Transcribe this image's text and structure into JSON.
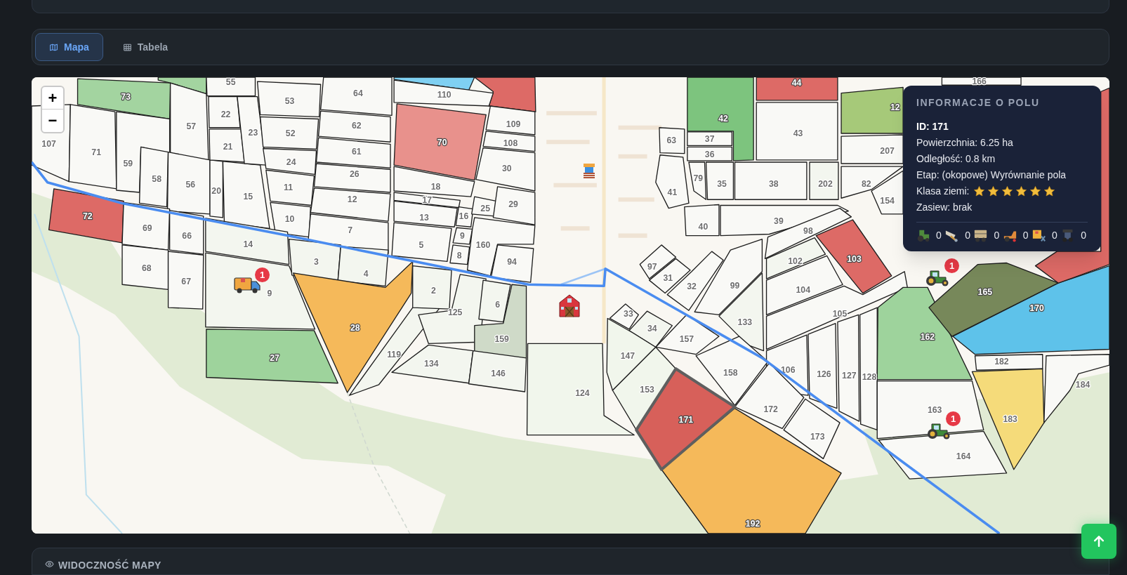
{
  "tabs": [
    {
      "label": "Mapa",
      "kind": "map",
      "selected": true
    },
    {
      "label": "Tabela",
      "kind": "table",
      "selected": false
    }
  ],
  "map": {
    "zoom_in": "+",
    "zoom_out": "−",
    "fields": [
      {
        "label": "73",
        "color": "#a3d4a0",
        "selected": false
      },
      {
        "color": "#a3d4a0",
        "selected": false
      },
      {
        "label": "107",
        "color": "#f9f9f6",
        "selected": false
      },
      {
        "label": "57",
        "color": "#f9f9f6",
        "selected": false
      },
      {
        "label": "71",
        "color": "#f9f9f6",
        "selected": false
      },
      {
        "label": "59",
        "color": "#f9f9f6",
        "selected": false
      },
      {
        "label": "58",
        "color": "#f9f9f6",
        "selected": false
      },
      {
        "label": "56",
        "color": "#f9f9f6",
        "selected": false
      },
      {
        "label": "20",
        "color": "#f9f9f6",
        "selected": false
      },
      {
        "label": "15",
        "color": "#f9f9f6",
        "selected": false
      },
      {
        "label": "55",
        "color": "#f9f9f6",
        "selected": false
      },
      {
        "label": "22",
        "color": "#f9f9f6",
        "selected": false
      },
      {
        "label": "21",
        "color": "#f9f9f6",
        "selected": false
      },
      {
        "label": "23",
        "color": "#f9f9f6",
        "selected": false
      },
      {
        "label": "53",
        "color": "#f9f9f6",
        "selected": false
      },
      {
        "label": "52",
        "color": "#f9f9f6",
        "selected": false
      },
      {
        "label": "24",
        "color": "#f9f9f6",
        "selected": false
      },
      {
        "label": "11",
        "color": "#f9f9f6",
        "selected": false
      },
      {
        "label": "10",
        "color": "#f9f9f6",
        "selected": false
      },
      {
        "label": "64",
        "color": "#f9f9f6",
        "selected": false
      },
      {
        "label": "62",
        "color": "#f9f9f6",
        "selected": false
      },
      {
        "label": "61",
        "color": "#f9f9f6",
        "selected": false
      },
      {
        "label": "26",
        "color": "#f9f9f6",
        "selected": false
      },
      {
        "label": "12",
        "color": "#f9f9f6",
        "selected": false
      },
      {
        "label": "7",
        "color": "#f9f9f6",
        "selected": false
      },
      {
        "label": "72",
        "color": "#dd6a66",
        "selected": false
      },
      {
        "label": "69",
        "color": "#f9f9f6",
        "selected": false
      },
      {
        "label": "66",
        "color": "#f9f9f6",
        "selected": false
      },
      {
        "label": "68",
        "color": "#f9f9f6",
        "selected": false
      },
      {
        "label": "67",
        "color": "#f9f9f6",
        "selected": false
      },
      {
        "label": "14",
        "color": "#f3f6ef",
        "selected": false
      },
      {
        "label": "9",
        "color": "#f3f6ef",
        "selected": false
      },
      {
        "label": "3",
        "color": "#f3f6ef",
        "selected": false
      },
      {
        "label": "4",
        "color": "#f3f6ef",
        "selected": false
      },
      {
        "label": "28",
        "color": "#f5b95a",
        "selected": false
      },
      {
        "label": "27",
        "color": "#9ed39c",
        "selected": false
      },
      {
        "label": "119",
        "color": "#f3f6ef",
        "selected": false
      },
      {
        "label": "2",
        "color": "#f3f6ef",
        "selected": false
      },
      {
        "label": "125",
        "color": "#f3f6ef",
        "selected": false
      },
      {
        "label": "6",
        "color": "#f3f6ef",
        "selected": false
      },
      {
        "label": "159",
        "color": "#cfdac8",
        "selected": false
      },
      {
        "label": "134",
        "color": "#f3f6ef",
        "selected": false
      },
      {
        "label": "146",
        "color": "#f3f6ef",
        "selected": false
      },
      {
        "label": "124",
        "color": "#f1f6ec",
        "selected": false
      },
      {
        "color": "#7fd0f2",
        "selected": false
      },
      {
        "color": "#dd6a66",
        "selected": false
      },
      {
        "label": "110",
        "color": "#f9f9f6",
        "selected": false
      },
      {
        "label": "70",
        "color": "#e8918c",
        "selected": false
      },
      {
        "label": "109",
        "color": "#f9f9f6",
        "selected": false
      },
      {
        "label": "108",
        "color": "#f9f9f6",
        "selected": false
      },
      {
        "label": "30",
        "color": "#f9f9f6",
        "selected": false
      },
      {
        "label": "18",
        "color": "#f9f9f6",
        "selected": false
      },
      {
        "label": "17",
        "color": "#f9f9f6",
        "selected": false
      },
      {
        "label": "13",
        "color": "#f9f9f6",
        "selected": false
      },
      {
        "label": "16",
        "color": "#f9f9f6",
        "selected": false
      },
      {
        "label": "25",
        "color": "#f9f9f6",
        "selected": false
      },
      {
        "label": "29",
        "color": "#f9f9f6",
        "selected": false
      },
      {
        "label": "9",
        "color": "#f9f9f6",
        "selected": false
      },
      {
        "label": "8",
        "color": "#f9f9f6",
        "selected": false
      },
      {
        "label": "5",
        "color": "#f9f9f6",
        "selected": false
      },
      {
        "label": "160",
        "color": "#f9f9f6",
        "selected": false
      },
      {
        "label": "94",
        "color": "#f9f9f6",
        "selected": false
      },
      {
        "label": "63",
        "color": "#f9f9f6",
        "selected": false
      },
      {
        "label": "42",
        "color": "#7dc47e",
        "selected": false
      },
      {
        "label": "37",
        "color": "#f9f9f6",
        "selected": false
      },
      {
        "label": "36",
        "color": "#f9f9f6",
        "selected": false
      },
      {
        "label": "44",
        "color": "#dd6a66",
        "selected": false
      },
      {
        "label": "166",
        "color": "#f9f9f6",
        "selected": false
      },
      {
        "label": "43",
        "color": "#f9f9f6",
        "selected": false
      },
      {
        "label": "41",
        "color": "#f9f9f6",
        "selected": false
      },
      {
        "label": "79",
        "color": "#f9f9f6",
        "selected": false
      },
      {
        "label": "35",
        "color": "#f9f9f6",
        "selected": false
      },
      {
        "label": "38",
        "color": "#f9f9f6",
        "selected": false
      },
      {
        "label": "202",
        "color": "#f3f6ef",
        "selected": false
      },
      {
        "label": "40",
        "color": "#f9f9f6",
        "selected": false
      },
      {
        "label": "39",
        "color": "#f9f9f6",
        "selected": false
      },
      {
        "label": "12",
        "color": "#a6c979",
        "selected": false
      },
      {
        "label": "207",
        "color": "#f9f9f6",
        "selected": false
      },
      {
        "label": "82",
        "color": "#f9f9f6",
        "selected": false
      },
      {
        "label": "154",
        "color": "#f9f9f6",
        "selected": false
      },
      {
        "label": "98",
        "color": "#f9f9f6",
        "selected": false
      },
      {
        "label": "102",
        "color": "#f3f6ef",
        "selected": false
      },
      {
        "label": "103",
        "color": "#dd6a66",
        "selected": false
      },
      {
        "label": "104",
        "color": "#f9f9f6",
        "selected": false
      },
      {
        "label": "105",
        "color": "#f9f9f6",
        "selected": false
      },
      {
        "label": "106",
        "color": "#f9f9f6",
        "selected": false
      },
      {
        "label": "126",
        "color": "#f9f9f6",
        "selected": false
      },
      {
        "label": "127",
        "color": "#f9f9f6",
        "selected": false
      },
      {
        "label": "128",
        "color": "#f9f9f6",
        "selected": false
      },
      {
        "label": "162",
        "color": "#9ed39c",
        "selected": false
      },
      {
        "label": "165",
        "color": "#77885a",
        "selected": false
      },
      {
        "label": "170",
        "color": "#5ec2ea",
        "selected": false
      },
      {
        "color": "#dd6a66",
        "selected": false
      },
      {
        "label": "182",
        "color": "#f9f9f6",
        "selected": false
      },
      {
        "label": "183",
        "color": "#f5db7a",
        "selected": false
      },
      {
        "label": "184",
        "color": "#f9f9f6",
        "selected": false
      },
      {
        "label": "163",
        "color": "#f9f9f6",
        "selected": false
      },
      {
        "label": "164",
        "color": "#f9f9f6",
        "selected": false
      },
      {
        "label": "97",
        "color": "#f9f9f6",
        "selected": false
      },
      {
        "label": "31",
        "color": "#f9f9f6",
        "selected": false
      },
      {
        "label": "32",
        "color": "#f9f9f6",
        "selected": false
      },
      {
        "label": "99",
        "color": "#f9f9f6",
        "selected": false
      },
      {
        "label": "133",
        "color": "#f3f6ef",
        "selected": false
      },
      {
        "label": "33",
        "color": "#f9f9f6",
        "selected": false
      },
      {
        "label": "34",
        "color": "#f3f6ef",
        "selected": false
      },
      {
        "label": "157",
        "color": "#f9f9f6",
        "selected": false
      },
      {
        "label": "147",
        "color": "#f1f6ec",
        "selected": false
      },
      {
        "label": "158",
        "color": "#f9f9f6",
        "selected": false
      },
      {
        "label": "153",
        "color": "#f1f6ec",
        "selected": false
      },
      {
        "label": "172",
        "color": "#f9f9f6",
        "selected": false
      },
      {
        "label": "171",
        "color": "#d7605a",
        "selected": true
      },
      {
        "label": "173",
        "color": "#f9f9f6",
        "selected": false
      },
      {
        "label": "192",
        "color": "#f5b95a",
        "selected": false
      }
    ],
    "markers": [
      {
        "kind": "truck",
        "count": "1"
      },
      {
        "kind": "tractor",
        "count": "1"
      },
      {
        "kind": "tractor",
        "count": "1"
      },
      {
        "kind": "barn"
      },
      {
        "kind": "building"
      }
    ],
    "popup": {
      "title": "INFORMACJE O POLU",
      "id": "ID: 171",
      "area": "Powierzchnia: 6.25 ha",
      "distance": "Odległość: 0.8 km",
      "stage": "Etap: (okopowe) Wyrównanie pola",
      "soil_label": "Klasa ziemi:",
      "stars": 6,
      "sowing": "Zasiew: brak",
      "equipment": [
        {
          "kind": "tractor",
          "count": "0"
        },
        {
          "kind": "seeder",
          "count": "0"
        },
        {
          "kind": "sprayer",
          "count": "0"
        },
        {
          "kind": "cultivator",
          "count": "0"
        },
        {
          "kind": "trailer",
          "count": "0"
        },
        {
          "kind": "harvester",
          "count": "0"
        }
      ]
    }
  },
  "visibility_panel": {
    "title": "WIDOCZNOŚĆ MAPY"
  }
}
